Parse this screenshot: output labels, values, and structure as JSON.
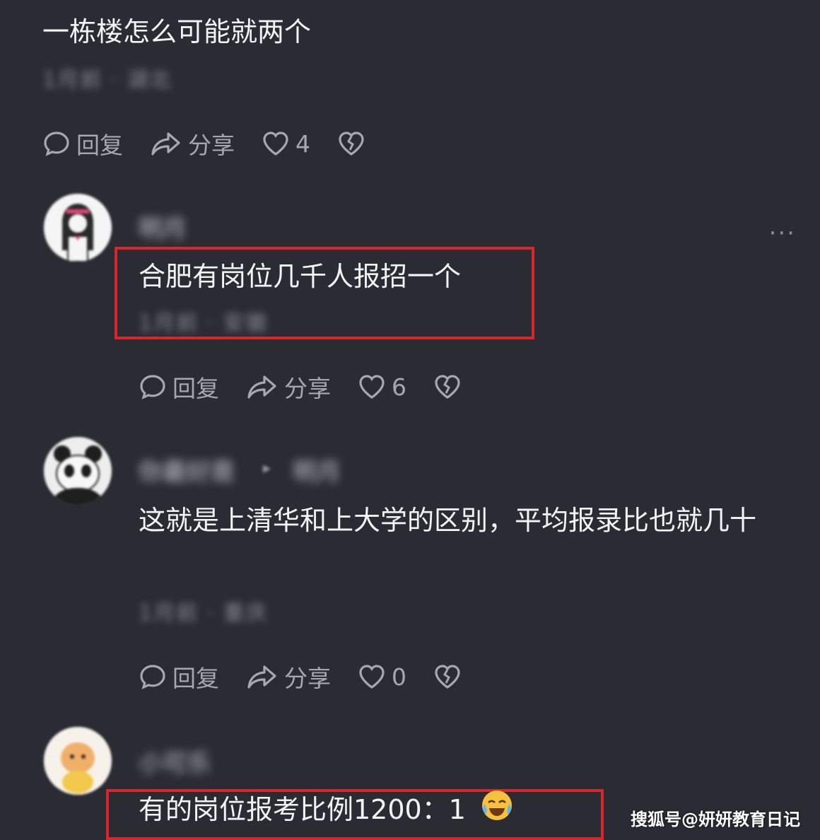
{
  "comments": [
    {
      "username": "",
      "text": "一栋楼怎么可能就两个",
      "meta": "1月前 · 湖北",
      "actions": {
        "reply": "回复",
        "share": "分享",
        "likes": "4"
      }
    },
    {
      "username": "明月",
      "text": "合肥有岗位几千人报招一个",
      "meta": "1月前 · 安徽",
      "actions": {
        "reply": "回复",
        "share": "分享",
        "likes": "6"
      }
    },
    {
      "username": "你最好是",
      "reply_to": "明月",
      "text": "这就是上清华和上大学的区别，平均报录比也就几十",
      "meta": "1月前 · 重庆",
      "actions": {
        "reply": "回复",
        "share": "分享",
        "likes": "0"
      }
    },
    {
      "username": "小可乐",
      "text": "有的岗位报考比例1200：1",
      "emoji": "crying-laughing-emoji"
    }
  ],
  "more_menu": "···",
  "watermark": "搜狐号@妍妍教育日记",
  "colors": {
    "background": "#2a2b33",
    "highlight_box": "#d8262a",
    "action_text": "#a6a7b0"
  }
}
